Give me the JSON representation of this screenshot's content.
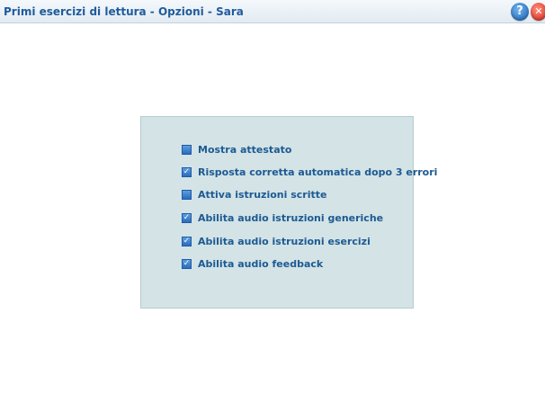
{
  "window": {
    "title": "Primi esercizi di lettura - Opzioni - Sara",
    "help_glyph": "?",
    "close_glyph": "✕"
  },
  "options": [
    {
      "label": "Mostra attestato",
      "checked": false
    },
    {
      "label": "Risposta corretta automatica dopo 3 errori",
      "checked": true
    },
    {
      "label": "Attiva istruzioni scritte",
      "checked": false
    },
    {
      "label": "Abilita audio istruzioni generiche",
      "checked": true
    },
    {
      "label": "Abilita audio istruzioni esercizi",
      "checked": true
    },
    {
      "label": "Abilita audio feedback",
      "checked": true
    }
  ],
  "colors": {
    "title_text": "#1f5b9c",
    "panel_bg": "#d3e3e6",
    "checkbox": "#2b6cbf",
    "label_text": "#1d5a92"
  },
  "icons": {
    "help": "help-icon",
    "close": "close-icon",
    "checkbox_checked": "checkmark-icon"
  }
}
